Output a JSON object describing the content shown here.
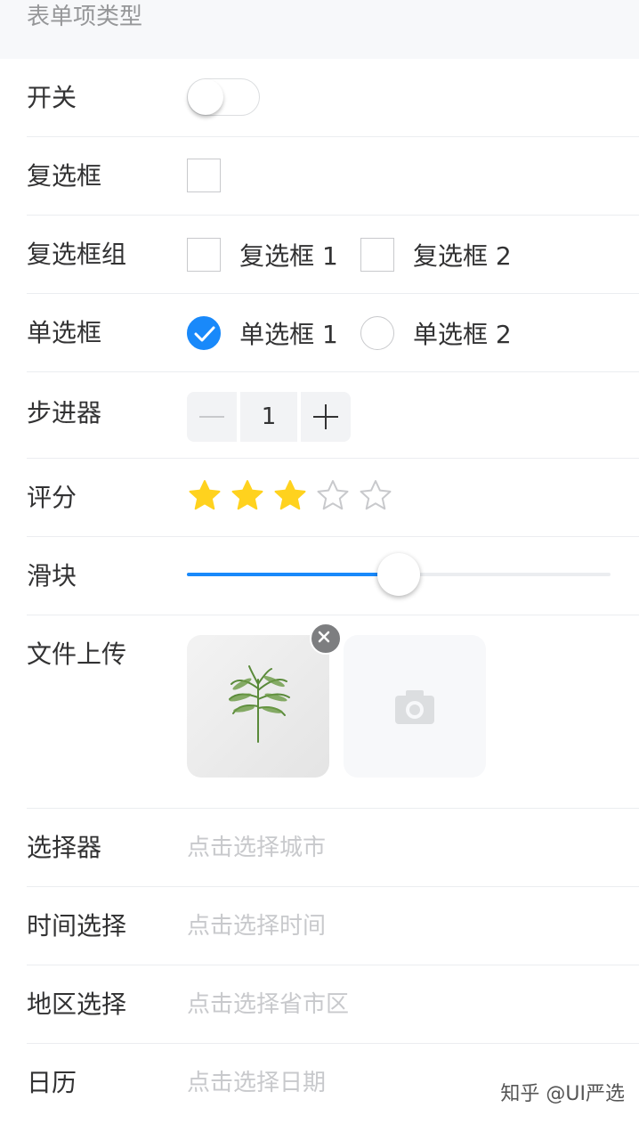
{
  "section": {
    "title": "表单项类型"
  },
  "switch_row": {
    "label": "开关",
    "on": false
  },
  "checkbox_row": {
    "label": "复选框",
    "checked": false
  },
  "checkbox_group_row": {
    "label": "复选框组",
    "options": [
      {
        "label": "复选框 1",
        "checked": false
      },
      {
        "label": "复选框 2",
        "checked": false
      }
    ]
  },
  "radio_row": {
    "label": "单选框",
    "options": [
      {
        "label": "单选框 1",
        "checked": true
      },
      {
        "label": "单选框 2",
        "checked": false
      }
    ]
  },
  "stepper_row": {
    "label": "步进器",
    "value": "1"
  },
  "rate_row": {
    "label": "评分",
    "value": 3,
    "max": 5
  },
  "slider_row": {
    "label": "滑块",
    "value_percent": 50
  },
  "upload_row": {
    "label": "文件上传",
    "icons": [
      "image-thumbnail",
      "close-icon",
      "camera-icon"
    ]
  },
  "picker_row": {
    "label": "选择器",
    "placeholder": "点击选择城市"
  },
  "time_row": {
    "label": "时间选择",
    "placeholder": "点击选择时间"
  },
  "area_row": {
    "label": "地区选择",
    "placeholder": "点击选择省市区"
  },
  "calendar_row": {
    "label": "日历",
    "placeholder": "点击选择日期"
  },
  "watermark": "知乎 @UI严选",
  "colors": {
    "accent": "#1989fa",
    "star": "#ffd21e",
    "placeholder": "#c8c9cc"
  }
}
